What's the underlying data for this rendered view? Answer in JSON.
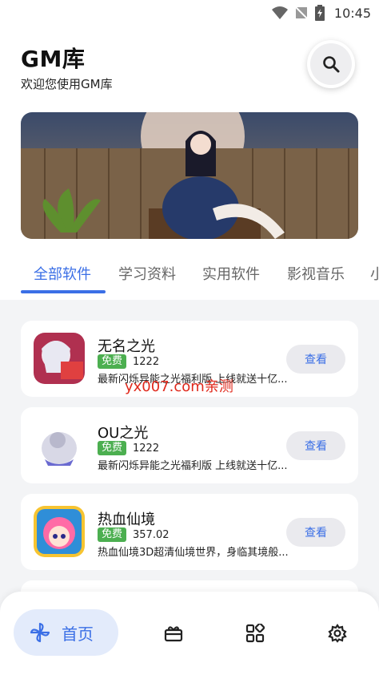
{
  "status": {
    "time": "10:45"
  },
  "header": {
    "title": "GM库",
    "subtitle": "欢迎您使用GM库"
  },
  "tabs": [
    {
      "label": "全部软件"
    },
    {
      "label": "学习资料"
    },
    {
      "label": "实用软件"
    },
    {
      "label": "影视音乐"
    },
    {
      "label": "小"
    }
  ],
  "apps": [
    {
      "name": "无名之光",
      "badge": "免费",
      "size": "1222",
      "desc": "最新闪烁异能之光福利版 上线就送十亿...",
      "action": "查看"
    },
    {
      "name": "OU之光",
      "badge": "免费",
      "size": "1222",
      "desc": "最新闪烁异能之光福利版 上线就送十亿...",
      "action": "查看"
    },
    {
      "name": "热血仙境",
      "badge": "免费",
      "size": "357.02",
      "desc": "热血仙境3D超清仙境世界，身临其境般...",
      "action": "查看"
    }
  ],
  "watermark": "yx007.com亲测",
  "bottom_nav": {
    "home_label": "首页"
  },
  "colors": {
    "accent": "#3b6fe6",
    "badge": "#4caf50",
    "watermark": "#e0281b"
  }
}
